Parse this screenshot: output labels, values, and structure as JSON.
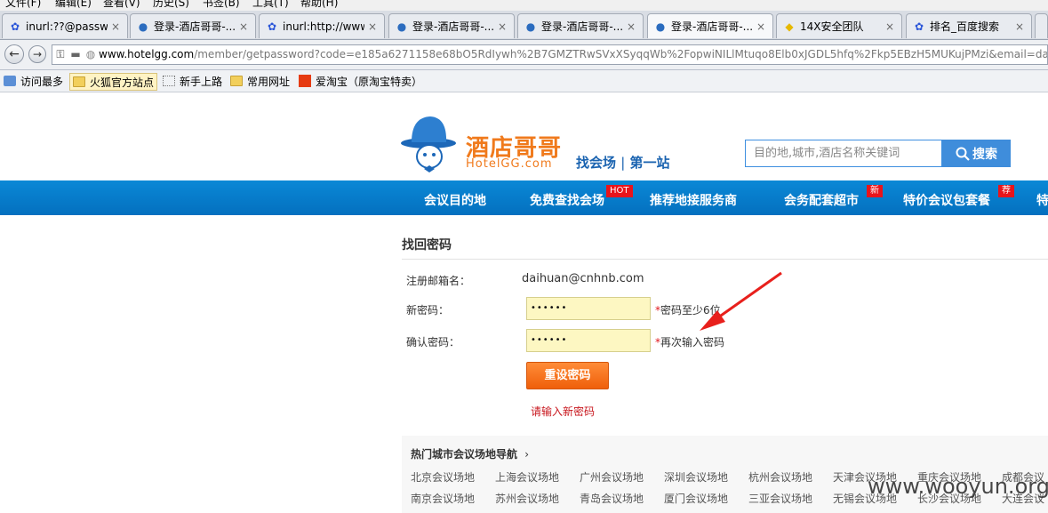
{
  "browser": {
    "menu": [
      "文件(F)",
      "编辑(E)",
      "查看(V)",
      "历史(S)",
      "书签(B)",
      "工具(T)",
      "帮助(H)"
    ],
    "tabs": [
      {
        "label": "inurl:??@passw...",
        "icon": "baidu-paw-icon"
      },
      {
        "label": "登录-酒店哥哥-...",
        "icon": "hotel-hat-icon"
      },
      {
        "label": "inurl:http://www...",
        "icon": "baidu-paw-icon"
      },
      {
        "label": "登录-酒店哥哥-...",
        "icon": "hotel-hat-icon"
      },
      {
        "label": "登录-酒店哥哥-...",
        "icon": "hotel-hat-icon"
      },
      {
        "label": "登录-酒店哥哥-...",
        "icon": "hotel-hat-icon",
        "active": true
      },
      {
        "label": "14X安全团队",
        "icon": "yellow-site-icon"
      },
      {
        "label": "排名_百度搜索",
        "icon": "baidu-paw-icon"
      }
    ],
    "close_glyph": "×",
    "url_host": "www.hotelgg.com",
    "url_path": "/member/getpassword?code=e185a6271158e68bO5RdIywh%2B7GMZTRwSVxXSyqqWb%2FopwiNILlMtuqo8Elb0xJGDL5hfq%2Fkp5EBzH5MUKujPMzi&email=daih",
    "bookmarks": [
      "访问最多",
      "火狐官方站点",
      "新手上路",
      "常用网址",
      "爱淘宝（原淘宝特卖）"
    ]
  },
  "header": {
    "logo_cn": "酒店哥哥",
    "logo_en": "HotelGG.com",
    "slogan_a": "找会场",
    "slogan_sep": "|",
    "slogan_b": "第一站",
    "search_placeholder": "目的地,城市,酒店名称关键词",
    "search_button": "搜索"
  },
  "nav": {
    "items": [
      {
        "label": "会议目的地"
      },
      {
        "label": "免费查找会场",
        "badge": "HOT"
      },
      {
        "label": "推荐地接服务商"
      },
      {
        "label": "会务配套超市",
        "badge": "新"
      },
      {
        "label": "特价会议包套餐",
        "badge": "荐"
      },
      {
        "label": "特"
      }
    ]
  },
  "form": {
    "title": "找回密码",
    "email_label": "注册邮箱名：",
    "email_value": "daihuan@cnhnb.com",
    "new_pw_label": "新密码：",
    "new_pw_value": "••••••",
    "new_pw_hint_star": "*",
    "new_pw_hint": "密码至少6位",
    "confirm_label": "确认密码：",
    "confirm_value": "••••••",
    "confirm_hint_star": "*",
    "confirm_hint": "再次输入密码",
    "submit": "重设密码",
    "error": "请输入新密码"
  },
  "hot_cities": {
    "title": "热门城市会议场地导航",
    "row1": [
      "北京会议场地",
      "上海会议场地",
      "广州会议场地",
      "深圳会议场地",
      "杭州会议场地",
      "天津会议场地",
      "重庆会议场地",
      "成都会议"
    ],
    "row2": [
      "南京会议场地",
      "苏州会议场地",
      "青岛会议场地",
      "厦门会议场地",
      "三亚会议场地",
      "无锡会议场地",
      "长沙会议场地",
      "大连会议"
    ]
  },
  "watermark": "www.wooyun.org",
  "colors": {
    "nav_blue": "#0a7dca",
    "accent_orange": "#f07020",
    "error_red": "#c8161d",
    "input_yellow": "#fdf7c2"
  }
}
